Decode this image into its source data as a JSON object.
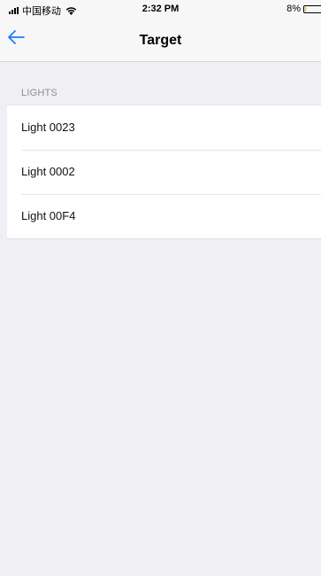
{
  "status_bar": {
    "carrier": "中国移动",
    "time": "2:32 PM",
    "battery_percent_label": "8%",
    "battery_level": 0.08,
    "battery_color": "#f5a623"
  },
  "nav": {
    "title": "Target",
    "back_icon": "arrow-left-icon",
    "accent_color": "#1a7cff"
  },
  "section": {
    "header": "LIGHTS"
  },
  "lights": [
    {
      "label": "Light 0023"
    },
    {
      "label": "Light 0002"
    },
    {
      "label": "Light 00F4"
    }
  ]
}
